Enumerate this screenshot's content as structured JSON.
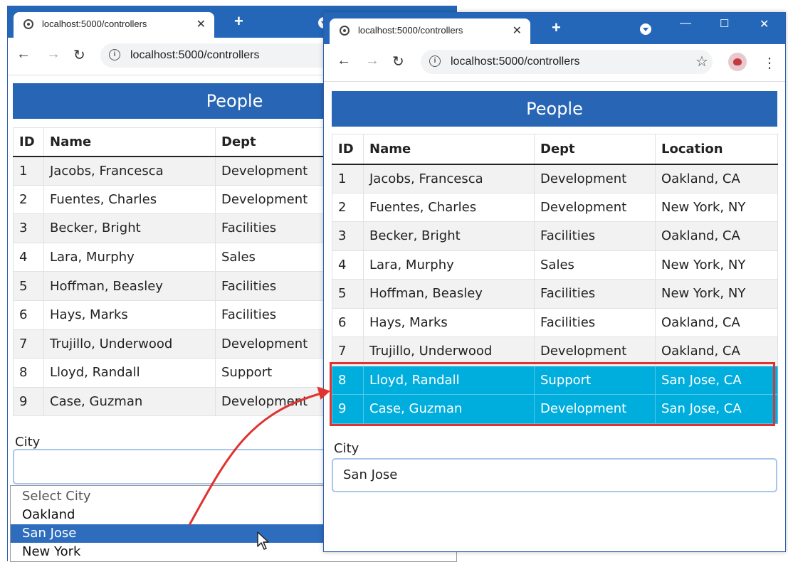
{
  "browser": {
    "tab_title": "localhost:5000/controllers",
    "url": "localhost:5000/controllers"
  },
  "page": {
    "heading": "People",
    "columns_back": [
      "ID",
      "Name",
      "Dept"
    ],
    "columns_front": [
      "ID",
      "Name",
      "Dept",
      "Location"
    ],
    "rows": [
      {
        "id": "1",
        "name": "Jacobs, Francesca",
        "dept": "Development",
        "location": "Oakland, CA"
      },
      {
        "id": "2",
        "name": "Fuentes, Charles",
        "dept": "Development",
        "location": "New York, NY"
      },
      {
        "id": "3",
        "name": "Becker, Bright",
        "dept": "Facilities",
        "location": "Oakland, CA"
      },
      {
        "id": "4",
        "name": "Lara, Murphy",
        "dept": "Sales",
        "location": "New York, NY"
      },
      {
        "id": "5",
        "name": "Hoffman, Beasley",
        "dept": "Facilities",
        "location": "New York, NY"
      },
      {
        "id": "6",
        "name": "Hays, Marks",
        "dept": "Facilities",
        "location": "Oakland, CA"
      },
      {
        "id": "7",
        "name": "Trujillo, Underwood",
        "dept": "Development",
        "location": "Oakland, CA"
      },
      {
        "id": "8",
        "name": "Lloyd, Randall",
        "dept": "Support",
        "location": "San Jose, CA"
      },
      {
        "id": "9",
        "name": "Case, Guzman",
        "dept": "Development",
        "location": "San Jose, CA"
      }
    ],
    "city_label": "City",
    "back_city_value": "",
    "front_city_value": "San Jose",
    "city_options": [
      "Select City",
      "Oakland",
      "San Jose",
      "New York"
    ],
    "selected_option": "San Jose"
  },
  "colors": {
    "tabstrip": "#2467b8",
    "heading": "#2866b5",
    "selected_row": "#00aede",
    "highlight_box": "#e0322f",
    "dropdown_active": "#2e6dbe"
  }
}
